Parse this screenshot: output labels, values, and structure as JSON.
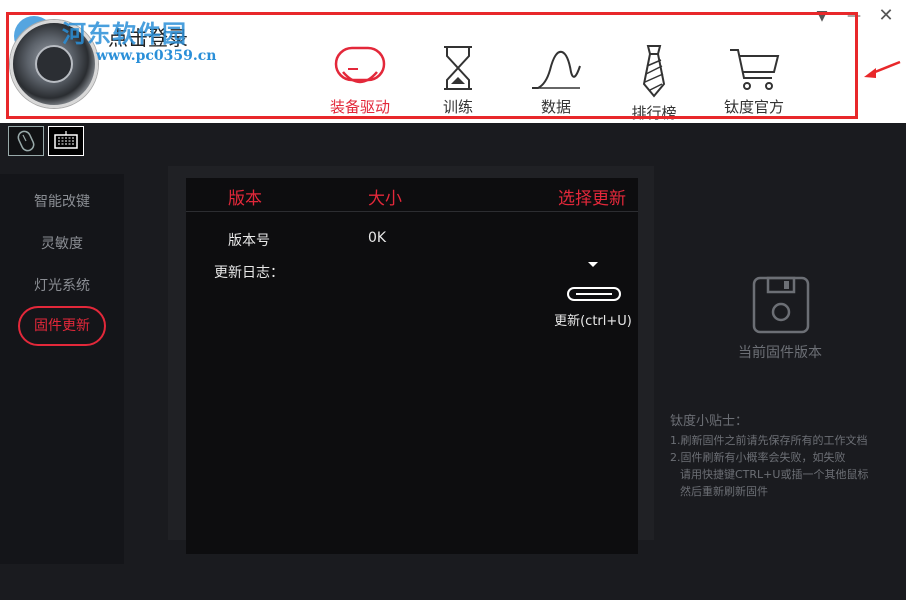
{
  "header": {
    "login_label": "点击登录",
    "watermark_text": "河东软件园",
    "watermark_url": "www.pc0359.cn"
  },
  "window_controls": {
    "dropdown": "▼",
    "minimize": "—",
    "close": "✕"
  },
  "nav": [
    {
      "label": "装备驱动",
      "icon": "device-driver-icon",
      "active": true
    },
    {
      "label": "训练",
      "icon": "hourglass-icon",
      "active": false
    },
    {
      "label": "数据",
      "icon": "curve-chart-icon",
      "active": false
    },
    {
      "label": "排行榜",
      "icon": "tie-icon",
      "active": false
    },
    {
      "label": "钛度官方",
      "icon": "shopping-cart-icon",
      "active": false
    }
  ],
  "devices": [
    {
      "name": "mouse-icon",
      "active": false
    },
    {
      "name": "keyboard-icon",
      "active": true
    }
  ],
  "sidebar": {
    "items": [
      {
        "label": "智能改键",
        "active": false
      },
      {
        "label": "灵敏度",
        "active": false
      },
      {
        "label": "灯光系统",
        "active": false
      },
      {
        "label": "固件更新",
        "active": true
      }
    ]
  },
  "firmware": {
    "headers": {
      "version": "版本",
      "size": "大小",
      "select": "选择更新"
    },
    "version_label": "版本号",
    "size_value": "0K",
    "changelog_label": "更新日志：",
    "update_button": "更新(ctrl+U)"
  },
  "right": {
    "current_version": "当前固件版本",
    "tips_title": "钛度小贴士：",
    "tips": [
      "1.刷新固件之前请先保存所有的工作文档",
      "2.固件刷新有小概率会失败，如失败",
      "请用快捷键CTRL+U或插一个其他鼠标",
      "然后重新刷新固件"
    ]
  },
  "colors": {
    "accent": "#e3283a",
    "annotation": "#e8282a",
    "watermark": "#2a8fd8"
  }
}
